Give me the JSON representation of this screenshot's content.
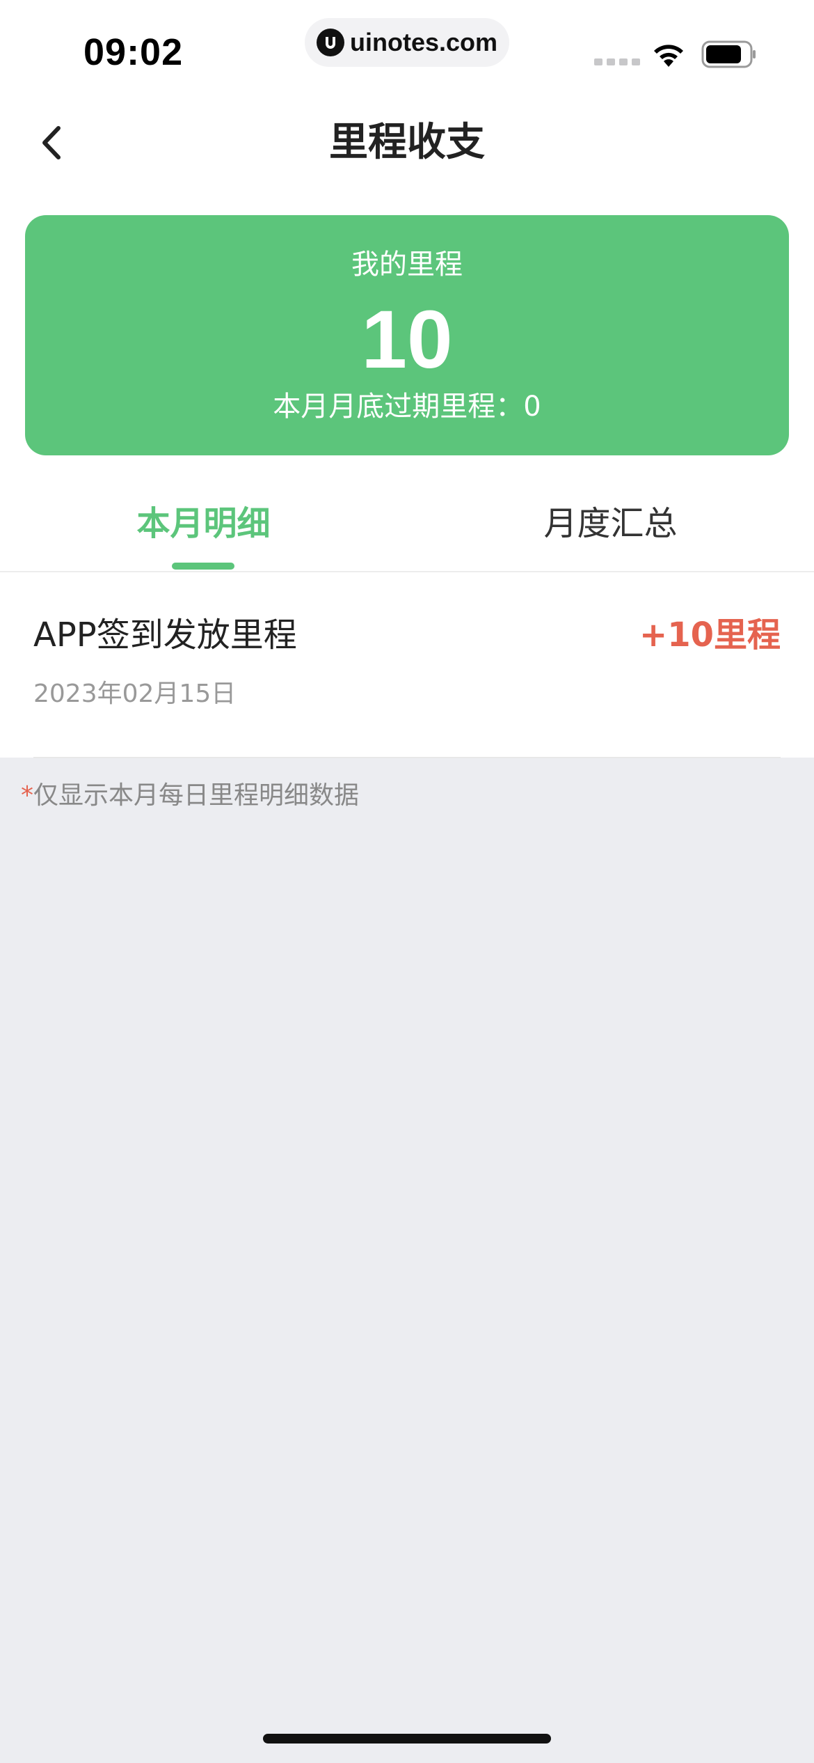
{
  "status_bar": {
    "time": "09:02",
    "url": "uinotes.com"
  },
  "nav": {
    "title": "里程收支",
    "back_icon": "chevron-left-icon"
  },
  "summary_card": {
    "label": "我的里程",
    "value": "10",
    "expiry_text": "本月月底过期里程：0",
    "background_color": "#5cc57b"
  },
  "tabs": [
    {
      "label": "本月明细",
      "active": true
    },
    {
      "label": "月度汇总",
      "active": false
    }
  ],
  "records": [
    {
      "title": "APP签到发放里程",
      "amount": "+10里程",
      "date": "2023年02月15日"
    }
  ],
  "note": {
    "star": "*",
    "text": "仅显示本月每日里程明细数据"
  },
  "colors": {
    "accent": "#5cc57b",
    "amount": "#e5634f",
    "page_background": "#ecedf1"
  }
}
